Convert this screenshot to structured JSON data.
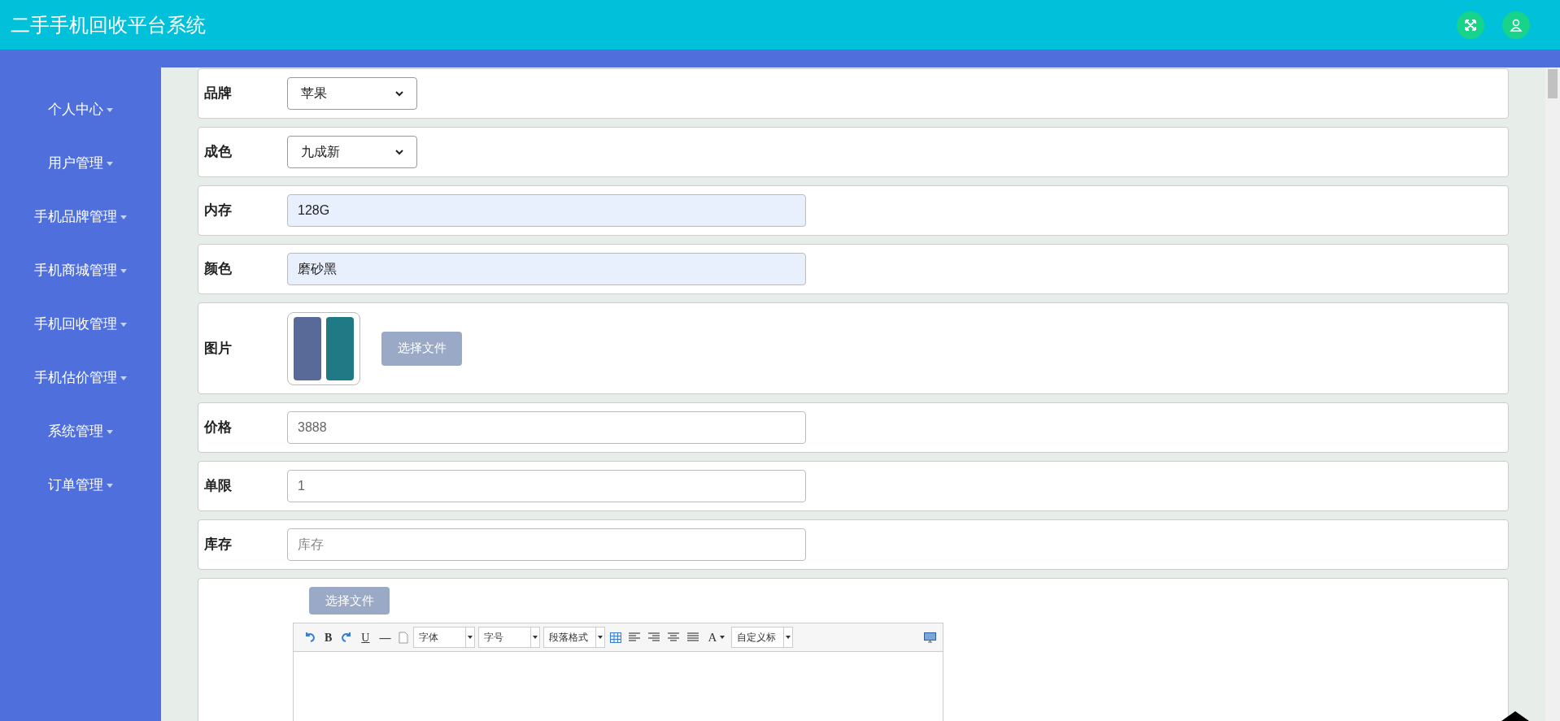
{
  "header": {
    "title": "二手手机回收平台系统"
  },
  "sidebar": {
    "items": [
      {
        "label": "个人中心",
        "expanded": false
      },
      {
        "label": "用户管理",
        "expanded": false
      },
      {
        "label": "手机品牌管理",
        "expanded": false
      },
      {
        "label": "手机商城管理",
        "expanded": false
      },
      {
        "label": "手机回收管理",
        "expanded": false
      },
      {
        "label": "手机估价管理",
        "expanded": false
      },
      {
        "label": "系统管理",
        "expanded": false
      },
      {
        "label": "订单管理",
        "expanded": false
      }
    ]
  },
  "form": {
    "fields": [
      {
        "kind": "select",
        "label": "品牌",
        "value": "苹果"
      },
      {
        "kind": "select",
        "label": "成色",
        "value": "九成新"
      },
      {
        "kind": "input",
        "label": "内存",
        "value": "128G",
        "autofilled": true
      },
      {
        "kind": "input",
        "label": "颜色",
        "value": "磨砂黑",
        "autofilled": true
      },
      {
        "kind": "image",
        "label": "图片",
        "button": "选择文件"
      },
      {
        "kind": "input",
        "label": "价格",
        "value": "3888",
        "autofilled": false
      },
      {
        "kind": "input",
        "label": "单限",
        "value": "1",
        "autofilled": false
      },
      {
        "kind": "input",
        "label": "库存",
        "placeholder": "库存",
        "autofilled": false
      },
      {
        "kind": "editor",
        "button": "选择文件",
        "toolbar": [
          {
            "kind": "undo"
          },
          {
            "kind": "char",
            "text": "B"
          },
          {
            "kind": "redo"
          },
          {
            "kind": "underline",
            "text": "U"
          },
          {
            "kind": "char",
            "text": "—"
          },
          {
            "kind": "page"
          },
          {
            "kind": "select",
            "text": "字体"
          },
          {
            "kind": "select",
            "text": "字号"
          },
          {
            "kind": "select",
            "text": "段落格式"
          },
          {
            "kind": "table"
          },
          {
            "kind": "align-left"
          },
          {
            "kind": "align-right"
          },
          {
            "kind": "align-center"
          },
          {
            "kind": "justify"
          },
          {
            "kind": "color",
            "text": "A"
          },
          {
            "kind": "select",
            "text": "自定义标"
          },
          {
            "kind": "preview"
          }
        ]
      }
    ]
  }
}
